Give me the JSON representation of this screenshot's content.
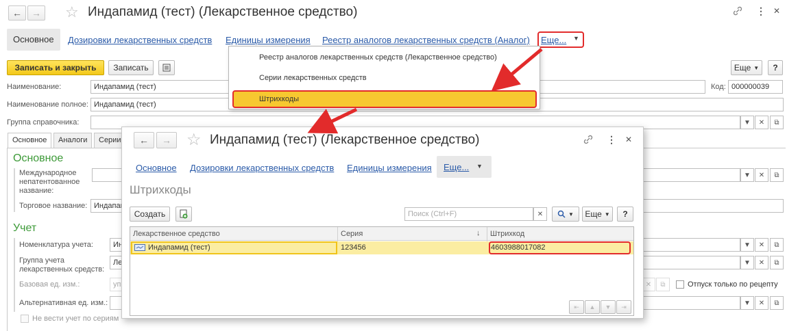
{
  "main": {
    "title": "Индапамид (тест) (Лекарственное средство)",
    "nav": {
      "back": "←",
      "forward": "→",
      "star": "☆",
      "link": "🔗",
      "more": "⋮",
      "close": "✕"
    },
    "tabs": [
      "Основное",
      "Дозировки лекарственных средств",
      "Единицы измерения",
      "Реестр аналогов лекарственных средств (Аналог)"
    ],
    "more_label": "Еще...",
    "toolbar": {
      "save_close": "Записать и закрыть",
      "save": "Записать",
      "more": "Еще"
    },
    "fields": {
      "name_label": "Наименование:",
      "name_value": "Индапамид (тест)",
      "code_label": "Код:",
      "code_value": "000000039",
      "fullname_label": "Наименование полное:",
      "fullname_value": "Индапамид (тест)",
      "group_label": "Группа справочника:"
    },
    "inner_tabs": [
      "Основное",
      "Аналоги",
      "Серии"
    ],
    "section_main": "Основное",
    "inn_label": "Международное непатентованное название:",
    "trade_label": "Торговое название:",
    "trade_value": "Индапамид",
    "section_account": "Учет",
    "nomen_label": "Номенклатура учета:",
    "nomen_value": "Ин",
    "group_acc_label": "Группа учета лекарственных средств:",
    "group_acc_value": "Ле",
    "base_unit_label": "Базовая ед. изм.:",
    "base_unit_value": "упа",
    "alt_unit_label": "Альтернативная ед. изм.:",
    "rx_label": "Отпуск только по рецепту",
    "no_series_label": "Не вести учет по сериям"
  },
  "dropdown": {
    "items": [
      "Реестр аналогов лекарственных средств (Лекарственное средство)",
      "Серии лекарственных средств",
      "Штрихкоды"
    ]
  },
  "popup": {
    "title": "Индапамид (тест) (Лекарственное средство)",
    "tabs": [
      "Основное",
      "Дозировки лекарственных средств",
      "Единицы измерения"
    ],
    "more_label": "Еще...",
    "heading": "Штрихкоды",
    "create_label": "Создать",
    "search_placeholder": "Поиск (Ctrl+F)",
    "more": "Еще",
    "help": "?",
    "columns": [
      "Лекарственное средство",
      "Серия",
      "Штрихкод"
    ],
    "rows": [
      {
        "drug": "Индапамид (тест)",
        "series": "123456",
        "barcode": "4603988017082"
      }
    ]
  },
  "colors": {
    "accent_link": "#2a5aa8",
    "highlight": "#f7c830",
    "callout": "#e22b2b",
    "section_green": "#3d9a38"
  }
}
